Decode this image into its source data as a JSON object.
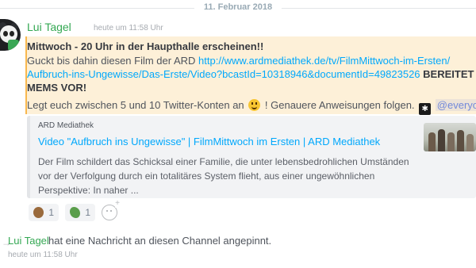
{
  "date_divider": "11. Februar 2018",
  "message": {
    "username": "Lui Tagel",
    "timestamp": "heute um 11:58 Uhr",
    "line1": "Mittwoch - 20 Uhr in der Haupthalle erscheinen!!",
    "line2_prefix": "Guckt bis dahin diesen Film der ARD ",
    "line2_link": "http://www.ardmediathek.de/tv/FilmMittwoch-im-Ersten/",
    "line3_link": "Aufbruch-ins-Ungewisse/Das-Erste/Video?bcastId=10318946&documentId=49823526",
    "line3_bold": " BEREITET",
    "line4_bold": "MEMS VOR!",
    "line5_prefix": "Legt euch zwischen 5 und 10 Twitter-Konten an ",
    "line5_suffix": " ! Genauere Anweisungen folgen. ",
    "mention": "@everyone",
    "emoji_smile": "smiley-emoji",
    "emoji_bt": "bluetooth-emoji"
  },
  "embed": {
    "provider": "ARD Mediathek",
    "title": "Video \"Aufbruch ins Ungewisse\" | FilmMittwoch im Ersten | ARD Mediathek",
    "description": "Der Film schildert das Schicksal einer Familie, die unter lebensbedrohlichen Umständen vor der Verfolgung durch ein totalitäres System flieht, aus einer ungewöhnlichen Perspektive: In naher ..."
  },
  "reactions": [
    {
      "emoji": "bear-emoji",
      "count": "1"
    },
    {
      "emoji": "pepe-frog-emoji",
      "count": "1"
    }
  ],
  "pin_notice": {
    "username": "Lui Tagel",
    "text": "hat eine Nachricht an diesen Channel angepinnt.",
    "timestamp": "heute um 11:58 Uhr"
  },
  "colors": {
    "username": "#34a853",
    "link": "#00a8fc",
    "highlight_bg": "#fdf0d8",
    "highlight_border": "#f8b84e"
  }
}
